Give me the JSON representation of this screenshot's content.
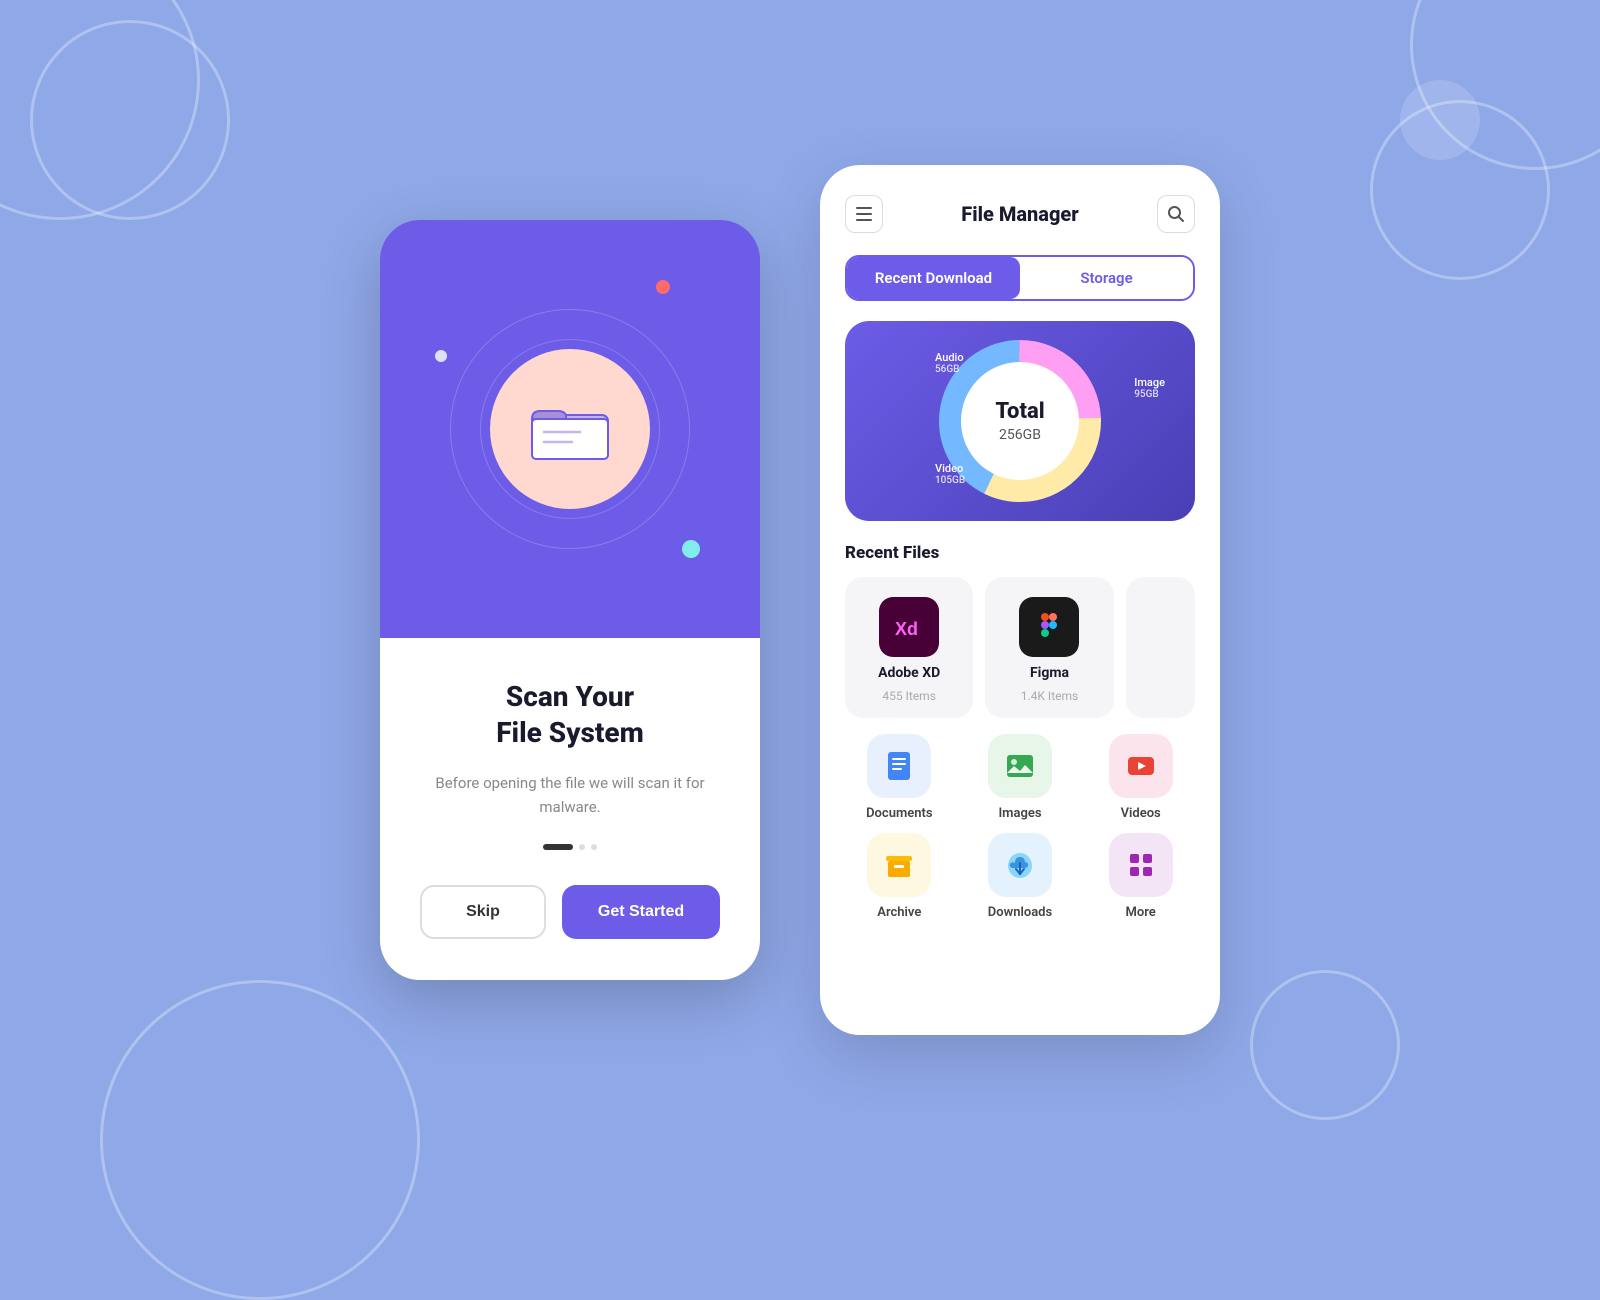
{
  "background": {
    "color": "#8fa8e8"
  },
  "left_card": {
    "title": "Scan Your\nFile System",
    "description": "Before opening the file we will scan it for malware.",
    "skip_label": "Skip",
    "get_started_label": "Get Started"
  },
  "right_card": {
    "header_title": "File Manager",
    "tabs": [
      {
        "label": "Recent Download",
        "active": true
      },
      {
        "label": "Storage",
        "active": false
      }
    ],
    "chart": {
      "total_label": "Total",
      "total_size": "256GB",
      "segments": [
        {
          "name": "Audio",
          "size": "56GB",
          "color": "#ff9ff3"
        },
        {
          "name": "Image",
          "size": "95GB",
          "color": "#ffeaa7"
        },
        {
          "name": "Video",
          "size": "105GB",
          "color": "#74b9ff"
        }
      ]
    },
    "recent_files_title": "Recent Files",
    "recent_files": [
      {
        "name": "Adobe XD",
        "count": "455 Items",
        "icon_label": "XD",
        "icon_bg": "#470137"
      },
      {
        "name": "Figma",
        "count": "1.4K Items",
        "icon_label": "F",
        "icon_bg": "#1a1a1a"
      }
    ],
    "categories": [
      {
        "name": "Documents",
        "icon": "📄",
        "bg_class": "cat-docs"
      },
      {
        "name": "Images",
        "icon": "🖼️",
        "bg_class": "cat-images"
      },
      {
        "name": "Videos",
        "icon": "▶️",
        "bg_class": "cat-videos"
      },
      {
        "name": "Archive",
        "icon": "🗂️",
        "bg_class": "cat-archive"
      },
      {
        "name": "Downloads",
        "icon": "☁️",
        "bg_class": "cat-downloads"
      },
      {
        "name": "More",
        "icon": "⬛",
        "bg_class": "cat-more"
      }
    ]
  }
}
